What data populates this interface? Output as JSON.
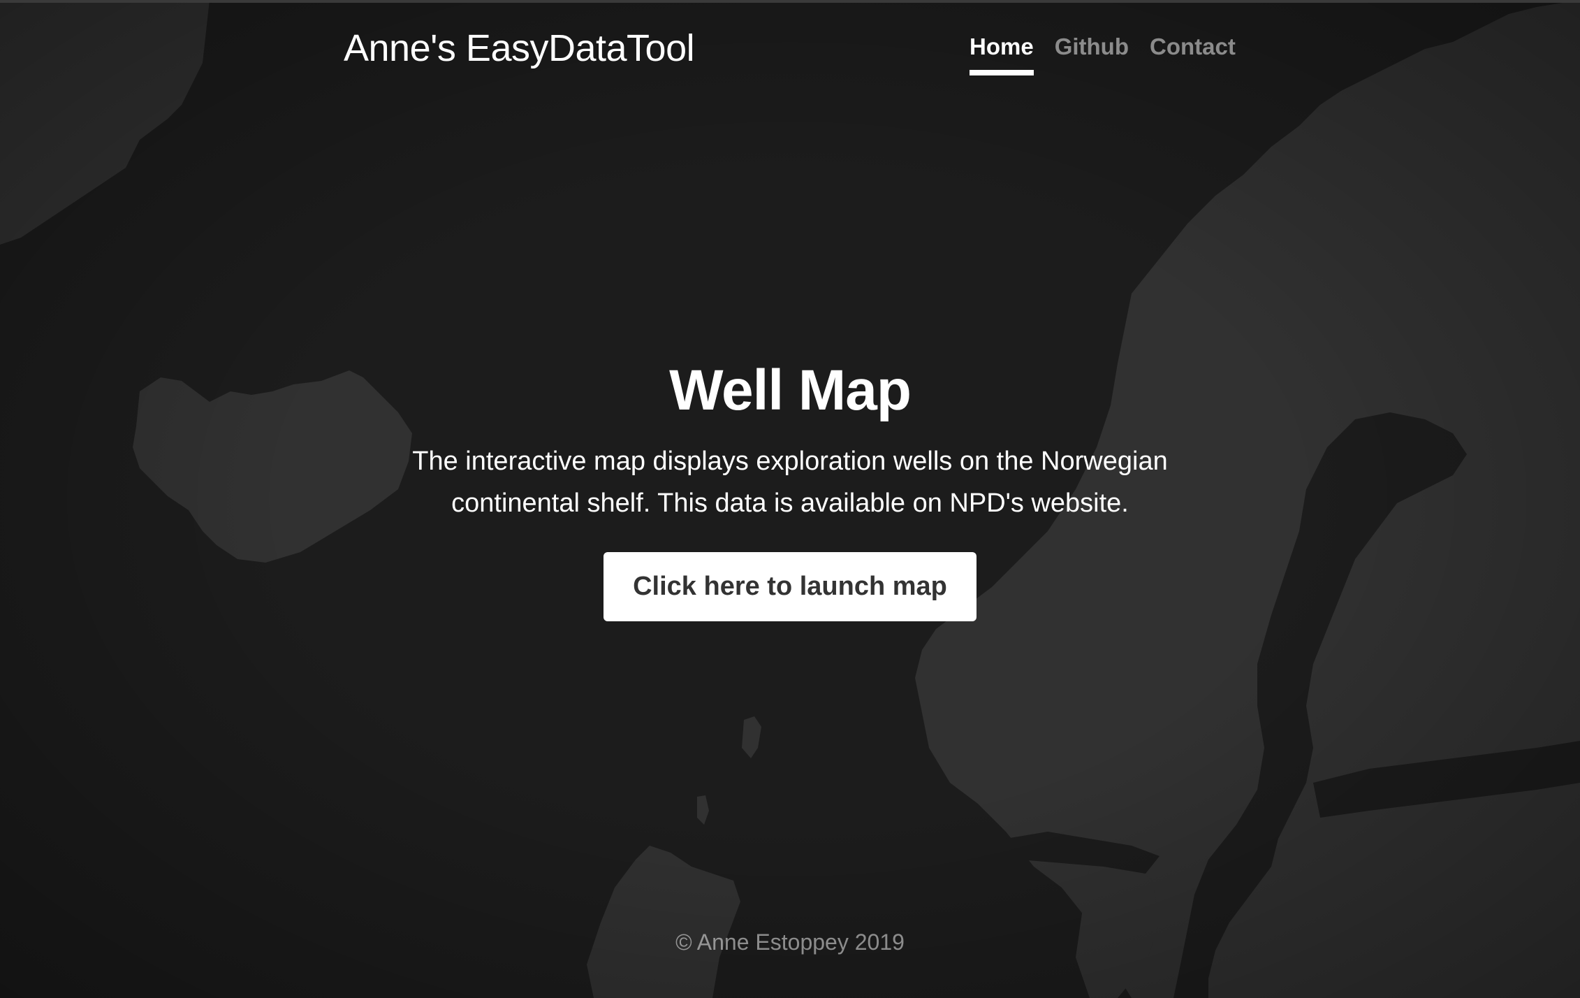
{
  "header": {
    "brand": "Anne's EasyDataTool",
    "nav": [
      {
        "label": "Home",
        "active": true
      },
      {
        "label": "Github",
        "active": false
      },
      {
        "label": "Contact",
        "active": false
      }
    ]
  },
  "main": {
    "heading": "Well Map",
    "lead_line1": "The interactive map displays exploration wells on the Norwegian",
    "lead_line2": "continental shelf. This data is available on NPD's website.",
    "button_label": "Click here to launch map"
  },
  "footer": {
    "text": "© Anne Estoppey 2019"
  },
  "colors": {
    "background": "#1c1c1c",
    "land": "#333333",
    "text": "#ffffff",
    "muted_text": "#808080",
    "button_bg": "#ffffff",
    "button_text": "#333333"
  }
}
